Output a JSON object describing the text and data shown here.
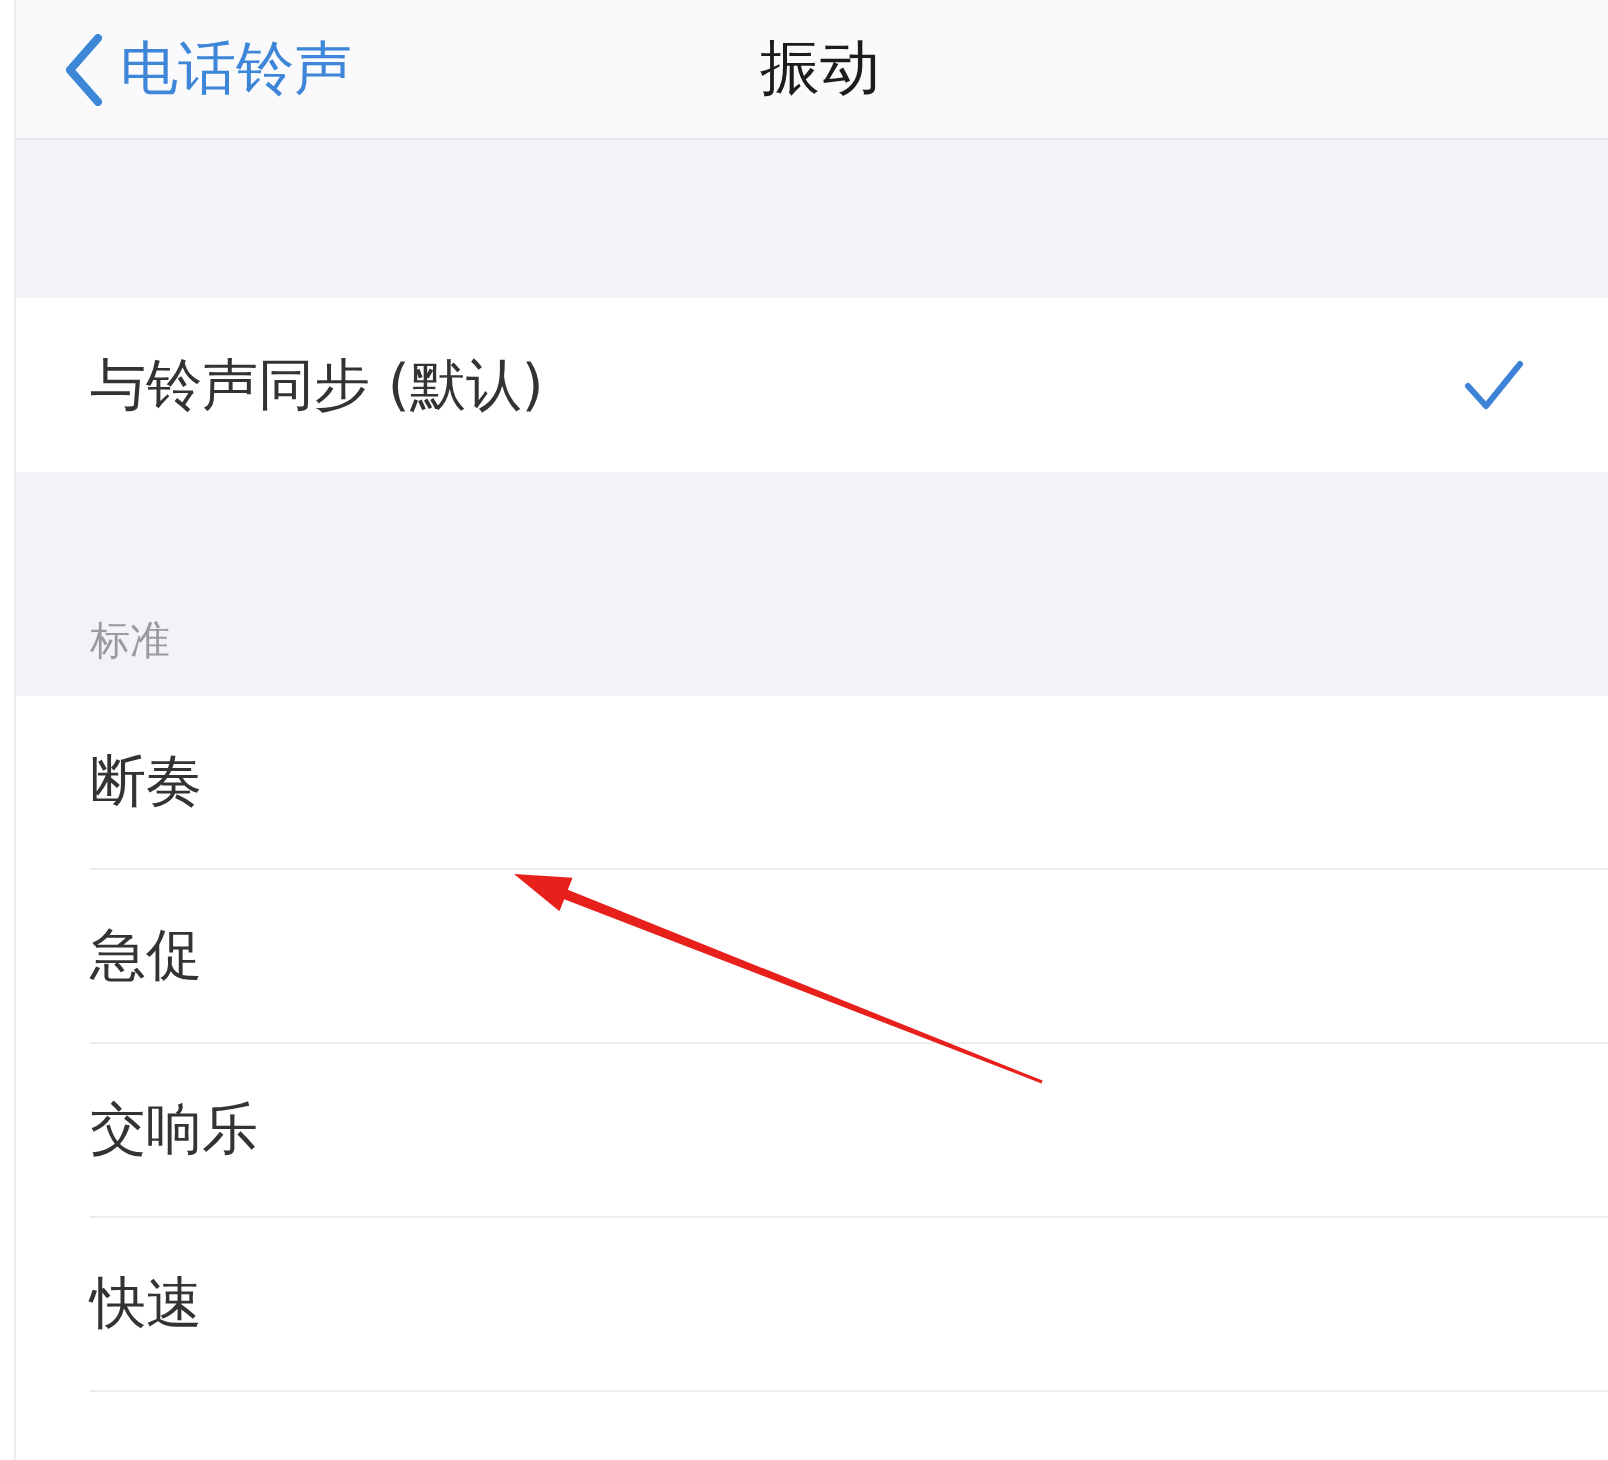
{
  "nav_bar": {
    "back_label": "电话铃声",
    "title": "振动"
  },
  "groups": [
    {
      "items": [
        {
          "label": "与铃声同步 (默认)",
          "selected": true
        }
      ]
    },
    {
      "header": "标准",
      "items": [
        {
          "label": "断奏",
          "selected": false
        },
        {
          "label": "急促",
          "selected": false
        },
        {
          "label": "交响乐",
          "selected": false
        },
        {
          "label": "快速",
          "selected": false
        }
      ]
    }
  ]
}
